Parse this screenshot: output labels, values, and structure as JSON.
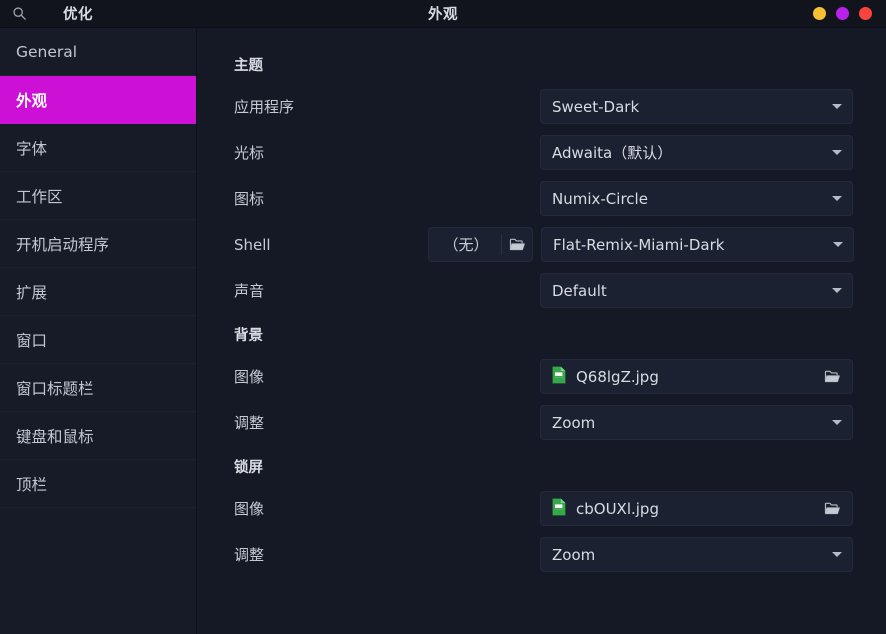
{
  "window": {
    "app_title": "优化",
    "page_title": "外观",
    "search_icon": "search-icon",
    "controls": [
      {
        "name": "minimize-button",
        "color": "#f5c033"
      },
      {
        "name": "maximize-button",
        "color": "#b821e8"
      },
      {
        "name": "close-button",
        "color": "#f9433f"
      }
    ]
  },
  "sidebar": {
    "items": [
      {
        "label": "General",
        "active": false
      },
      {
        "label": "外观",
        "active": true
      },
      {
        "label": "字体",
        "active": false
      },
      {
        "label": "工作区",
        "active": false
      },
      {
        "label": "开机启动程序",
        "active": false
      },
      {
        "label": "扩展",
        "active": false
      },
      {
        "label": "窗口",
        "active": false
      },
      {
        "label": "窗口标题栏",
        "active": false
      },
      {
        "label": "键盘和鼠标",
        "active": false
      },
      {
        "label": "顶栏",
        "active": false
      }
    ]
  },
  "content": {
    "sections": [
      {
        "title": "主题",
        "rows": [
          {
            "label": "应用程序",
            "widget": "combo",
            "value": "Sweet-Dark"
          },
          {
            "label": "光标",
            "widget": "combo",
            "value": "Adwaita（默认）"
          },
          {
            "label": "图标",
            "widget": "combo",
            "value": "Numix-Circle"
          },
          {
            "label": "Shell",
            "widget": "shell",
            "chooser_value": "（无）",
            "value": "Flat-Remix-Miami-Dark"
          },
          {
            "label": "声音",
            "widget": "combo",
            "value": "Default"
          }
        ]
      },
      {
        "title": "背景",
        "rows": [
          {
            "label": "图像",
            "widget": "file",
            "value": "Q68lgZ.jpg"
          },
          {
            "label": "调整",
            "widget": "combo",
            "value": "Zoom"
          }
        ]
      },
      {
        "title": "锁屏",
        "rows": [
          {
            "label": "图像",
            "widget": "file",
            "value": "cbOUXl.jpg"
          },
          {
            "label": "调整",
            "widget": "combo",
            "value": "Zoom"
          }
        ]
      }
    ]
  },
  "theme_colors": {
    "accent": "#cc10d6",
    "window_bg": "#151926",
    "sidebar_bg": "#171b28",
    "titlebar_bg": "#12141d",
    "widget_bg": "#1c2131",
    "file_icon_green": "#36a84a"
  }
}
